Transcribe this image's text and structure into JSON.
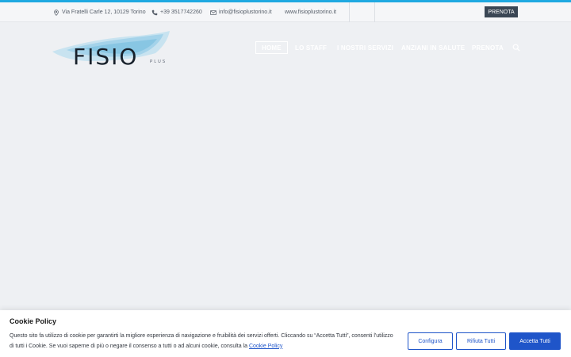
{
  "topbar": {
    "address": "Via Fratelli Carle 12, 10129 Torino",
    "phone": "+39 3517742260",
    "email": "info@fisioplustorino.it",
    "website": "www.fisioplustorino.it",
    "cta_label": "PRENOTA",
    "icons": {
      "address": "location-pin-icon",
      "phone": "phone-icon",
      "email": "envelope-icon"
    }
  },
  "logo": {
    "word": "FISIO",
    "suffix": "PLUS"
  },
  "nav": {
    "items": [
      {
        "label": "HOME",
        "active": true
      },
      {
        "label": "LO STAFF",
        "active": false
      },
      {
        "label": "I NOSTRI SERVIZI",
        "active": false
      },
      {
        "label": "ANZIANI IN SALUTE",
        "active": false
      },
      {
        "label": "PRENOTA",
        "active": false
      }
    ],
    "search_icon": "search-icon"
  },
  "cookie": {
    "title": "Cookie Policy",
    "text": "Questo sito fa utilizzo di cookie per garantirti la migliore esperienza di navigazione e fruibilità dei servizi offerti. Cliccando su “Accetta Tutti”, consenti l'utilizzo di tutti i Cookie. Se vuoi saperne di più o negare il consenso a tutti o ad alcuni cookie, consulta la ",
    "link": "Cookie Policy",
    "buttons": {
      "configure": "Configura",
      "reject": "Rifiuta Tutti",
      "accept": "Accetta Tutti"
    }
  },
  "colors": {
    "accent": "#1fa9e1",
    "cta_dark": "#3a4654",
    "cookie_blue": "#1f55c9",
    "background": "#eef0f3"
  }
}
